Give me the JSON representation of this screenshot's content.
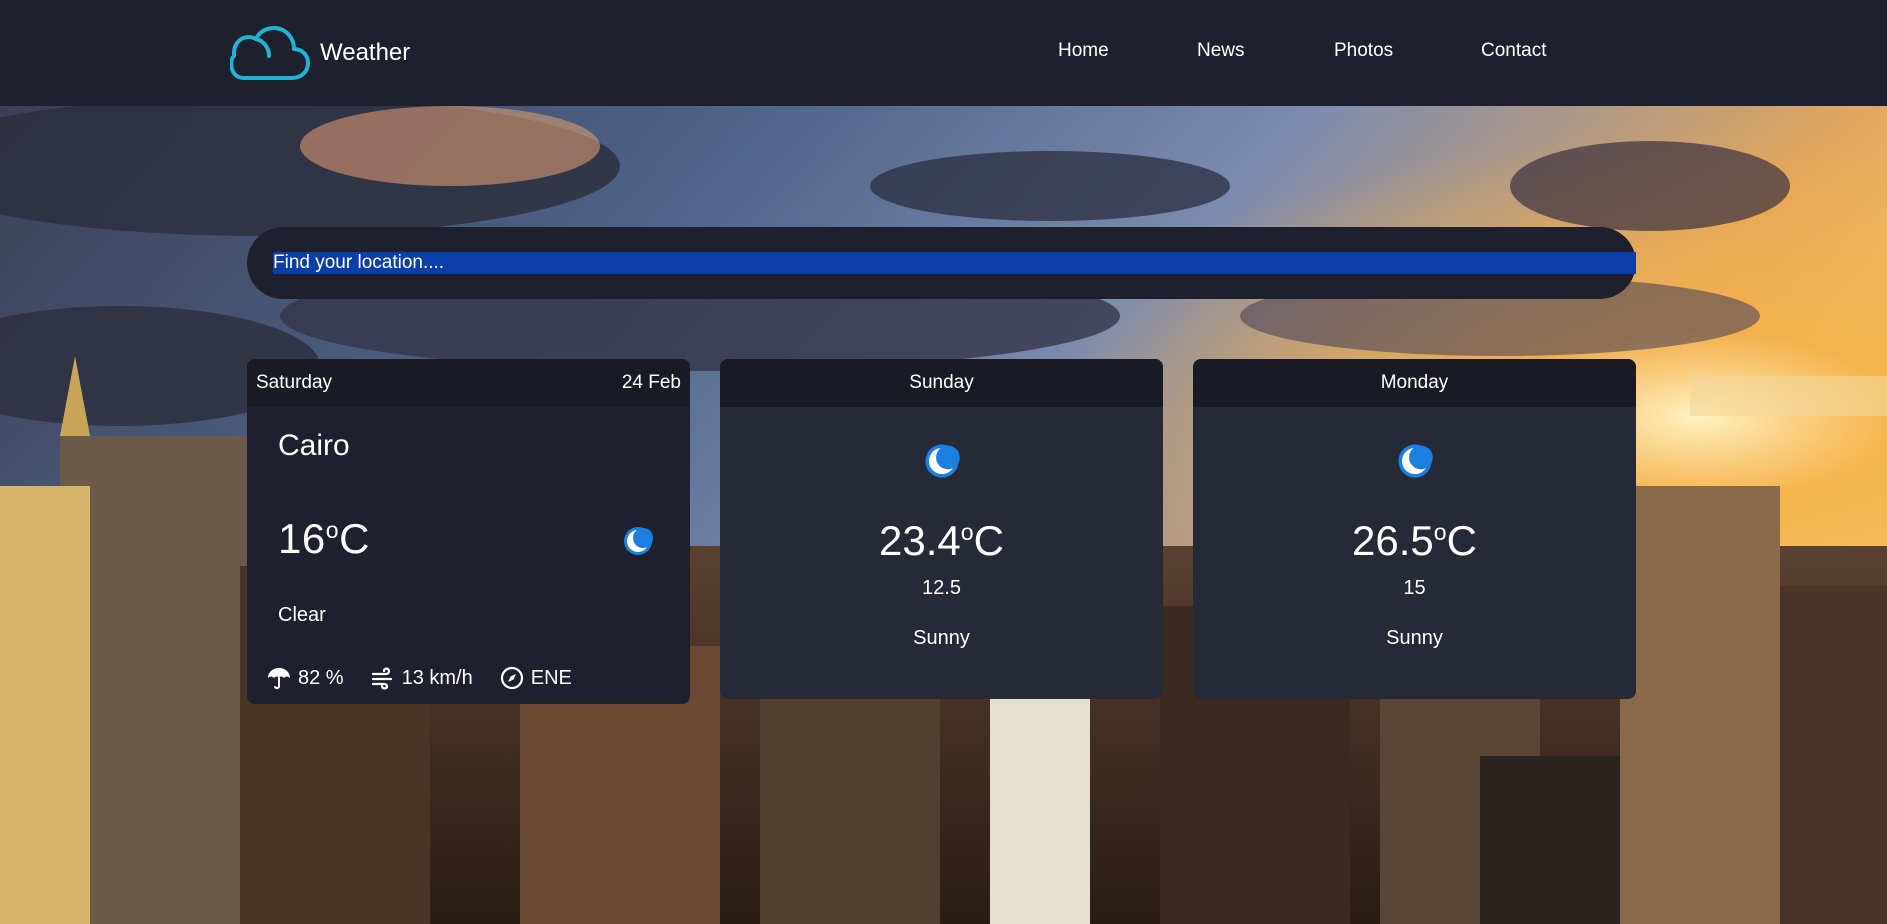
{
  "brand": {
    "name": "Weather",
    "icon": "cloud-icon",
    "accent": "#1fb3d6"
  },
  "nav": {
    "links": [
      "Home",
      "News",
      "Photos",
      "Contact"
    ]
  },
  "search": {
    "placeholder": "Find your location...."
  },
  "today": {
    "day": "Saturday",
    "date": "24 Feb",
    "city": "Cairo",
    "temp_value": "16",
    "temp_degree": "o",
    "temp_unit": "C",
    "icon": "moon-icon",
    "condition": "Clear",
    "humidity": "82 %",
    "wind_speed": "13 km/h",
    "wind_direction": "ENE"
  },
  "forecast": [
    {
      "day": "Sunday",
      "icon": "moon-icon",
      "max_value": "23.4",
      "degree": "o",
      "unit": "C",
      "min": "12.5",
      "condition": "Sunny"
    },
    {
      "day": "Monday",
      "icon": "moon-icon",
      "max_value": "26.5",
      "degree": "o",
      "unit": "C",
      "min": "15",
      "condition": "Sunny"
    }
  ],
  "colors": {
    "navbar": "#1e202e",
    "card": "#1e202e",
    "card_header": "#191a24",
    "search_highlight": "#0c3ea9",
    "moon": "#1a7fe0"
  }
}
